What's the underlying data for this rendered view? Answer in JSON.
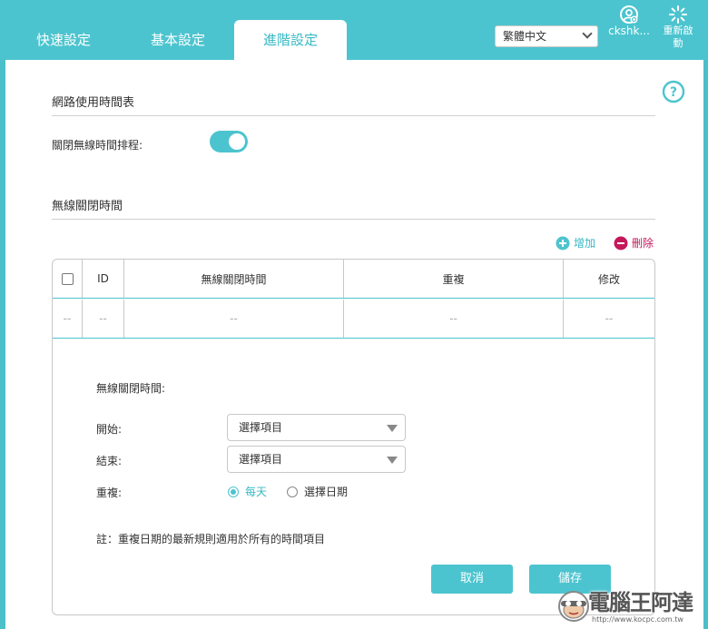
{
  "header": {
    "tabs": [
      {
        "label": "快速設定",
        "active": false
      },
      {
        "label": "基本設定",
        "active": false
      },
      {
        "label": "進階設定",
        "active": true
      }
    ],
    "language": "繁體中文",
    "user_name": "ckshk...",
    "reboot_label_line1": "重新啟",
    "reboot_label_line2": "動"
  },
  "page": {
    "section1_title": "網路使用時間表",
    "toggle_label": "關閉無線時間排程:",
    "toggle_on": true,
    "section2_title": "無線關閉時間",
    "add_label": "增加",
    "delete_label": "刪除"
  },
  "table": {
    "columns": [
      "",
      "ID",
      "無線關閉時間",
      "重複",
      "修改"
    ],
    "rows": [
      [
        "--",
        "--",
        "--",
        "--",
        "--"
      ]
    ]
  },
  "edit": {
    "title": "無線關閉時間:",
    "start_label": "開始:",
    "start_value": "選擇項目",
    "end_label": "結束:",
    "end_value": "選擇項目",
    "repeat_label": "重複:",
    "repeat_options": [
      {
        "label": "每天",
        "checked": true
      },
      {
        "label": "選擇日期",
        "checked": false
      }
    ],
    "note": "註：重複日期的最新規則適用於所有的時間項目",
    "cancel_label": "取消",
    "save_label": "儲存"
  },
  "watermark": {
    "text": "電腦王阿達",
    "url": "http://www.kocpc.com.tw"
  },
  "colors": {
    "accent": "#4cc4cf",
    "delete": "#c4185b"
  }
}
